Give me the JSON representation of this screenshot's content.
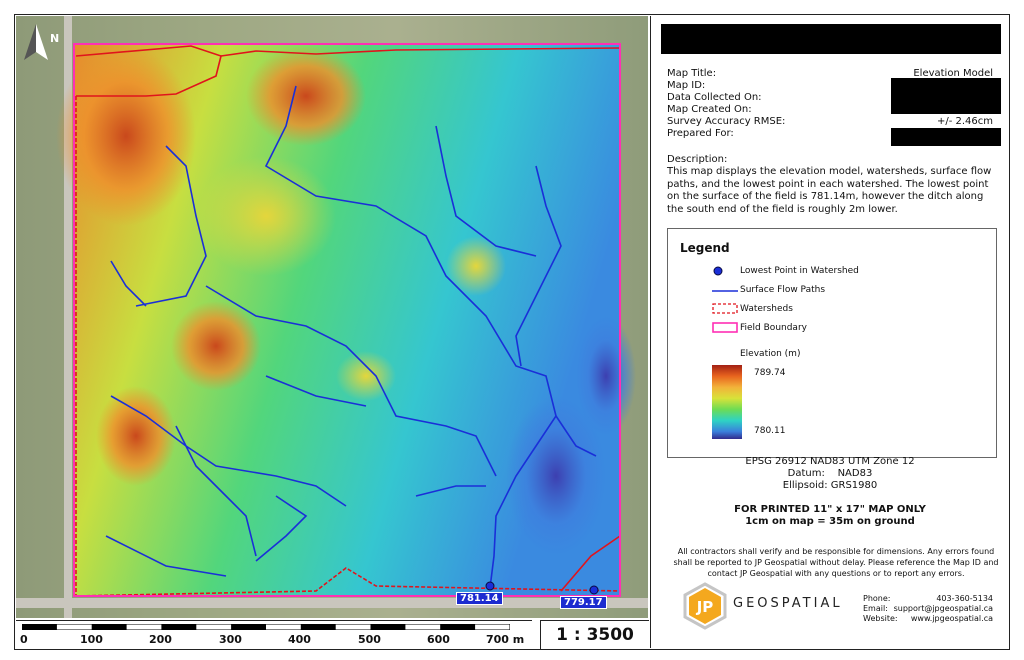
{
  "map": {
    "north_label": "N",
    "lowest_point_labels": [
      "781.14",
      "779.17"
    ]
  },
  "scale_bar": {
    "ticks": [
      "0",
      "100",
      "200",
      "300",
      "400",
      "500",
      "600",
      "700 m"
    ],
    "ratio": "1 : 3500"
  },
  "info": {
    "rows": [
      {
        "label": "Map Title:",
        "value": "Elevation Model"
      },
      {
        "label": "Map ID:",
        "value": ""
      },
      {
        "label": "Data Collected On:",
        "value": ""
      },
      {
        "label": "Map Created On:",
        "value": ""
      },
      {
        "label": "Survey Accuracy RMSE:",
        "value": "+/- 2.46cm"
      },
      {
        "label": "Prepared For:",
        "value": ""
      }
    ],
    "description_label": "Description:",
    "description": "This map displays the elevation model, watersheds, surface flow paths, and the lowest point in each watershed. The lowest point on the surface of the field is 781.14m, however the ditch along the south end of the field is roughly 2m lower."
  },
  "legend": {
    "title": "Legend",
    "items": [
      "Lowest Point in Watershed",
      "Surface Flow Paths",
      "Watersheds",
      "Field Boundary"
    ],
    "elevation_label": "Elevation (m)",
    "elevation_max": "789.74",
    "elevation_min": "780.11"
  },
  "projection": {
    "line1": "EPSG 26912 NAD83 UTM Zone 12",
    "line2": "Datum:    NAD83",
    "line3": "Ellipsoid: GRS1980"
  },
  "print_note": {
    "line1": "FOR PRINTED 11\" x 17\" MAP ONLY",
    "line2": "1cm on map = 35m on ground"
  },
  "disclaimer": "All contractors shall verify and be responsible for dimensions. Any errors found shall be reported to JP Geospatial without delay. Please reference the Map ID and contact JP Geospatial with any questions or to report any errors.",
  "brand": {
    "logo_text": "JP",
    "name": "GEOSPATIAL"
  },
  "contact": {
    "phone_label": "Phone:",
    "phone": "403-360-5134",
    "email_label": "Email:",
    "email": "support@jpgeospatial.ca",
    "website_label": "Website:",
    "website": "www.jpgeospatial.ca"
  },
  "colors": {
    "flow": "#1a2fd8",
    "watershed": "#e0141c",
    "boundary": "#ff2fb4"
  }
}
